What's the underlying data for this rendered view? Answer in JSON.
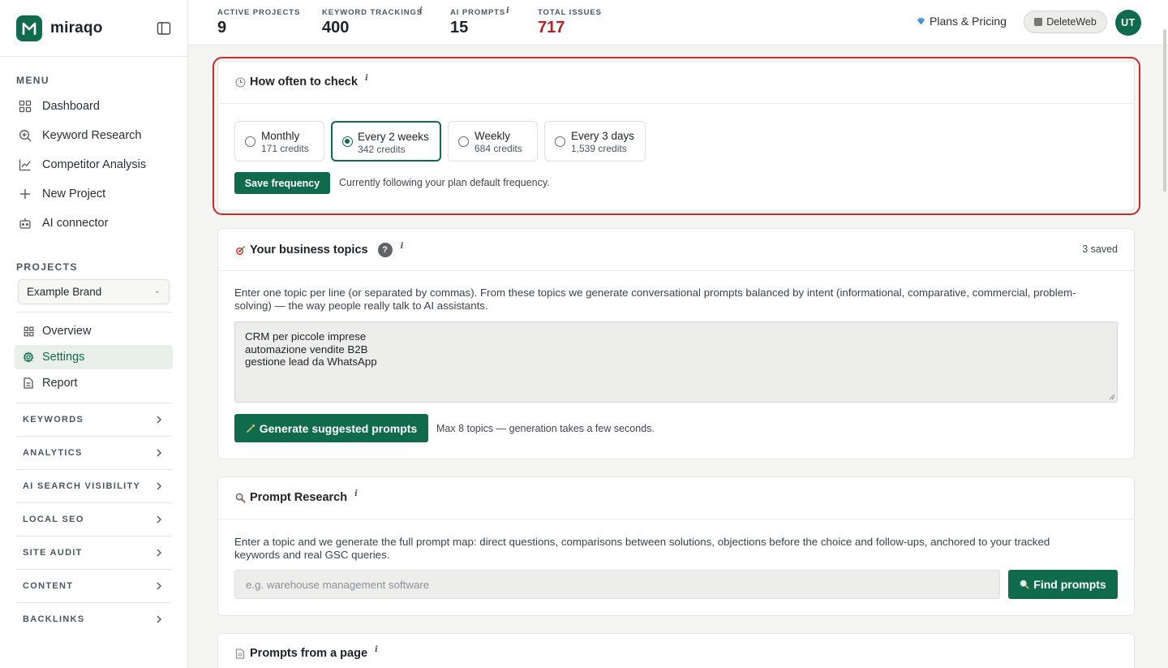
{
  "brand": {
    "name": "miraqo"
  },
  "sidebar": {
    "menu_title": "MENU",
    "menu": [
      {
        "label": "Dashboard",
        "icon": "grid-icon"
      },
      {
        "label": "Keyword Research",
        "icon": "search-plus-icon"
      },
      {
        "label": "Competitor Analysis",
        "icon": "chart-line-icon"
      },
      {
        "label": "New Project",
        "icon": "plus-icon"
      },
      {
        "label": "AI connector",
        "icon": "robot-icon"
      }
    ],
    "projects_title": "PROJECTS",
    "project_selected": "Example Brand",
    "project_items": [
      {
        "label": "Overview",
        "icon": "grid-icon"
      },
      {
        "label": "Settings",
        "icon": "gear-icon",
        "active": true
      },
      {
        "label": "Report",
        "icon": "document-icon"
      }
    ],
    "groups": [
      "KEYWORDS",
      "ANALYTICS",
      "AI SEARCH VISIBILITY",
      "LOCAL SEO",
      "SITE AUDIT",
      "CONTENT",
      "BACKLINKS"
    ]
  },
  "topbar": {
    "stats": [
      {
        "label": "ACTIVE PROJECTS",
        "value": "9",
        "info": false
      },
      {
        "label": "KEYWORD TRACKINGS",
        "value": "400",
        "info": true
      },
      {
        "label": "AI PROMPTS",
        "value": "15",
        "info": true
      },
      {
        "label": "TOTAL ISSUES",
        "value": "717",
        "info": false,
        "color": "#b42323"
      }
    ],
    "plans_label": "Plans & Pricing",
    "workspace_label": "DeleteWeb",
    "avatar_initials": "UT"
  },
  "frequency": {
    "title": "How often to check",
    "info": "i",
    "options": [
      {
        "label": "Monthly",
        "credits": "171 credits",
        "selected": false
      },
      {
        "label": "Every 2 weeks",
        "credits": "342 credits",
        "selected": true
      },
      {
        "label": "Weekly",
        "credits": "684 credits",
        "selected": false
      },
      {
        "label": "Every 3 days",
        "credits": "1,539 credits",
        "selected": false
      }
    ],
    "save_label": "Save frequency",
    "status_text": "Currently following your plan default frequency."
  },
  "topics": {
    "title": "Your business topics",
    "help": "?",
    "info": "i",
    "saved": "3 saved",
    "description": "Enter one topic per line (or separated by commas). From these topics we generate conversational prompts balanced by intent (informational, comparative, commercial, problem-solving) — the way people really talk to AI assistants.",
    "description_line1": "Enter one topic per line (or separated by commas). From these topics we generate conversational prompts balanced by intent (informational, comparative, commercial, problem-",
    "description_line2": "solving) — the way people really talk to AI assistants.",
    "lines": [
      "CRM per piccole imprese",
      "automazione vendite B2B",
      "gestione lead da WhatsApp"
    ],
    "generate_label": "Generate suggested prompts",
    "hint": "Max 8 topics — generation takes a few seconds."
  },
  "research": {
    "title": "Prompt Research",
    "info": "i",
    "description_line1": "Enter a topic and we generate the full prompt map: direct questions, comparisons between solutions, objections before the choice and follow-ups, anchored to your tracked",
    "description_line2": "keywords and real GSC queries.",
    "placeholder": "e.g. warehouse management software",
    "find_label": "Find prompts"
  },
  "page_prompts": {
    "title": "Prompts from a page",
    "info": "i"
  },
  "colors": {
    "accent": "#0f6b4c",
    "issues": "#b42323",
    "highlight": "#c92a2a"
  }
}
